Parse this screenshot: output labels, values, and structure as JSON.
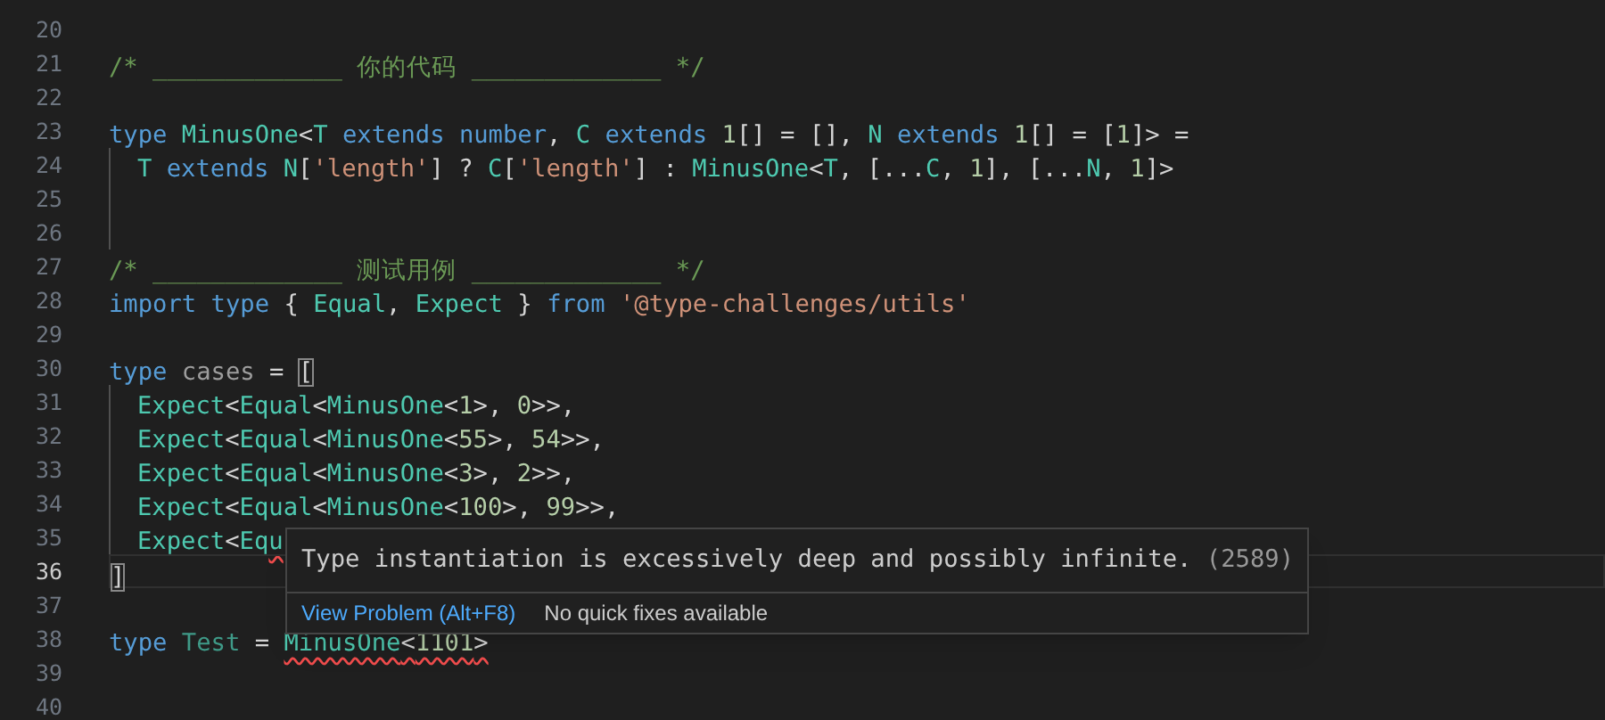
{
  "editor": {
    "lines": [
      {
        "number": "20",
        "current": false,
        "indent_guide": false
      },
      {
        "number": "21",
        "current": false,
        "indent_guide": false,
        "tokens": [
          {
            "kind": "comment",
            "text": "/* _____________ 你的代码 _____________ */"
          }
        ]
      },
      {
        "number": "22",
        "current": false,
        "indent_guide": false
      },
      {
        "number": "23",
        "current": false,
        "indent_guide": false,
        "tokens": [
          {
            "kind": "keyword",
            "text": "type "
          },
          {
            "kind": "type",
            "text": "MinusOne"
          },
          {
            "kind": "plain",
            "text": "<"
          },
          {
            "kind": "type",
            "text": "T"
          },
          {
            "kind": "keyword",
            "text": " extends number"
          },
          {
            "kind": "plain",
            "text": ", "
          },
          {
            "kind": "type",
            "text": "C"
          },
          {
            "kind": "keyword",
            "text": " extends "
          },
          {
            "kind": "number",
            "text": "1"
          },
          {
            "kind": "plain",
            "text": "[] = [], "
          },
          {
            "kind": "type",
            "text": "N"
          },
          {
            "kind": "keyword",
            "text": " extends "
          },
          {
            "kind": "number",
            "text": "1"
          },
          {
            "kind": "plain",
            "text": "[] = ["
          },
          {
            "kind": "number",
            "text": "1"
          },
          {
            "kind": "plain",
            "text": "]> ="
          }
        ]
      },
      {
        "number": "24",
        "current": false,
        "indent_guide": true,
        "tokens": [
          {
            "kind": "type",
            "text": "T"
          },
          {
            "kind": "keyword",
            "text": " extends "
          },
          {
            "kind": "type",
            "text": "N"
          },
          {
            "kind": "plain",
            "text": "["
          },
          {
            "kind": "string",
            "text": "'length'"
          },
          {
            "kind": "plain",
            "text": "] ? "
          },
          {
            "kind": "type",
            "text": "C"
          },
          {
            "kind": "plain",
            "text": "["
          },
          {
            "kind": "string",
            "text": "'length'"
          },
          {
            "kind": "plain",
            "text": "] : "
          },
          {
            "kind": "type",
            "text": "MinusOne"
          },
          {
            "kind": "plain",
            "text": "<"
          },
          {
            "kind": "type",
            "text": "T"
          },
          {
            "kind": "plain",
            "text": ", [..."
          },
          {
            "kind": "type",
            "text": "C"
          },
          {
            "kind": "plain",
            "text": ", "
          },
          {
            "kind": "number",
            "text": "1"
          },
          {
            "kind": "plain",
            "text": "], [..."
          },
          {
            "kind": "type",
            "text": "N"
          },
          {
            "kind": "plain",
            "text": ", "
          },
          {
            "kind": "number",
            "text": "1"
          },
          {
            "kind": "plain",
            "text": "]>"
          }
        ]
      },
      {
        "number": "25",
        "current": false,
        "indent_guide": true
      },
      {
        "number": "26",
        "current": false,
        "indent_guide": true
      },
      {
        "number": "27",
        "current": false,
        "indent_guide": false,
        "tokens": [
          {
            "kind": "comment",
            "text": "/* _____________ 测试用例 _____________ */"
          }
        ]
      },
      {
        "number": "28",
        "current": false,
        "indent_guide": false,
        "tokens": [
          {
            "kind": "keyword",
            "text": "import type "
          },
          {
            "kind": "plain",
            "text": "{ "
          },
          {
            "kind": "type",
            "text": "Equal"
          },
          {
            "kind": "plain",
            "text": ", "
          },
          {
            "kind": "type",
            "text": "Expect"
          },
          {
            "kind": "plain",
            "text": " } "
          },
          {
            "kind": "keyword",
            "text": "from "
          },
          {
            "kind": "string",
            "text": "'@type-challenges/utils'"
          }
        ]
      },
      {
        "number": "29",
        "current": false,
        "indent_guide": false
      },
      {
        "number": "30",
        "current": false,
        "indent_guide": false,
        "tokens": [
          {
            "kind": "keyword",
            "text": "type "
          },
          {
            "kind": "faded-plain",
            "text": "cases"
          },
          {
            "kind": "plain",
            "text": " = "
          },
          {
            "kind": "bracket-match",
            "text": "["
          }
        ]
      },
      {
        "number": "31",
        "current": false,
        "indent_guide": true,
        "tokens": [
          {
            "kind": "type",
            "text": "Expect"
          },
          {
            "kind": "plain",
            "text": "<"
          },
          {
            "kind": "type",
            "text": "Equal"
          },
          {
            "kind": "plain",
            "text": "<"
          },
          {
            "kind": "type",
            "text": "MinusOne"
          },
          {
            "kind": "plain",
            "text": "<"
          },
          {
            "kind": "number",
            "text": "1"
          },
          {
            "kind": "plain",
            "text": ">, "
          },
          {
            "kind": "number",
            "text": "0"
          },
          {
            "kind": "plain",
            "text": ">>,"
          }
        ]
      },
      {
        "number": "32",
        "current": false,
        "indent_guide": true,
        "tokens": [
          {
            "kind": "type",
            "text": "Expect"
          },
          {
            "kind": "plain",
            "text": "<"
          },
          {
            "kind": "type",
            "text": "Equal"
          },
          {
            "kind": "plain",
            "text": "<"
          },
          {
            "kind": "type",
            "text": "MinusOne"
          },
          {
            "kind": "plain",
            "text": "<"
          },
          {
            "kind": "number",
            "text": "55"
          },
          {
            "kind": "plain",
            "text": ">, "
          },
          {
            "kind": "number",
            "text": "54"
          },
          {
            "kind": "plain",
            "text": ">>,"
          }
        ]
      },
      {
        "number": "33",
        "current": false,
        "indent_guide": true,
        "tokens": [
          {
            "kind": "type",
            "text": "Expect"
          },
          {
            "kind": "plain",
            "text": "<"
          },
          {
            "kind": "type",
            "text": "Equal"
          },
          {
            "kind": "plain",
            "text": "<"
          },
          {
            "kind": "type",
            "text": "MinusOne"
          },
          {
            "kind": "plain",
            "text": "<"
          },
          {
            "kind": "number",
            "text": "3"
          },
          {
            "kind": "plain",
            "text": ">, "
          },
          {
            "kind": "number",
            "text": "2"
          },
          {
            "kind": "plain",
            "text": ">>,"
          }
        ]
      },
      {
        "number": "34",
        "current": false,
        "indent_guide": true,
        "tokens": [
          {
            "kind": "type",
            "text": "Expect"
          },
          {
            "kind": "plain",
            "text": "<"
          },
          {
            "kind": "type",
            "text": "Equal"
          },
          {
            "kind": "plain",
            "text": "<"
          },
          {
            "kind": "type",
            "text": "MinusOne"
          },
          {
            "kind": "plain",
            "text": "<"
          },
          {
            "kind": "number",
            "text": "100"
          },
          {
            "kind": "plain",
            "text": ">, "
          },
          {
            "kind": "number",
            "text": "99"
          },
          {
            "kind": "plain",
            "text": ">>,"
          }
        ]
      },
      {
        "number": "35",
        "current": false,
        "indent_guide": true,
        "tokens": [
          {
            "kind": "type",
            "text": "Expect"
          },
          {
            "kind": "plain",
            "text": "<"
          },
          {
            "kind": "type",
            "text": "Eq"
          },
          {
            "kind": "type-error",
            "text": "u"
          }
        ]
      },
      {
        "number": "36",
        "current": true,
        "indent_guide": false,
        "tokens": [
          {
            "kind": "bracket-match",
            "text": "]"
          }
        ]
      },
      {
        "number": "37",
        "current": false,
        "indent_guide": false
      },
      {
        "number": "38",
        "current": false,
        "indent_guide": false,
        "tokens": [
          {
            "kind": "keyword",
            "text": "type "
          },
          {
            "kind": "faded-type",
            "text": "Test"
          },
          {
            "kind": "plain",
            "text": " = "
          },
          {
            "kind": "type-error",
            "text": "MinusOne"
          },
          {
            "kind": "plain-error",
            "text": "<"
          },
          {
            "kind": "number-error",
            "text": "1101"
          },
          {
            "kind": "plain-error",
            "text": ">"
          }
        ]
      },
      {
        "number": "39",
        "current": false,
        "indent_guide": false
      },
      {
        "number": "40",
        "current": false,
        "indent_guide": false
      }
    ]
  },
  "hover": {
    "message": "Type instantiation is excessively deep and possibly infinite.",
    "code": "(2589)",
    "action": "View Problem (Alt+F8)",
    "status": "No quick fixes available"
  }
}
